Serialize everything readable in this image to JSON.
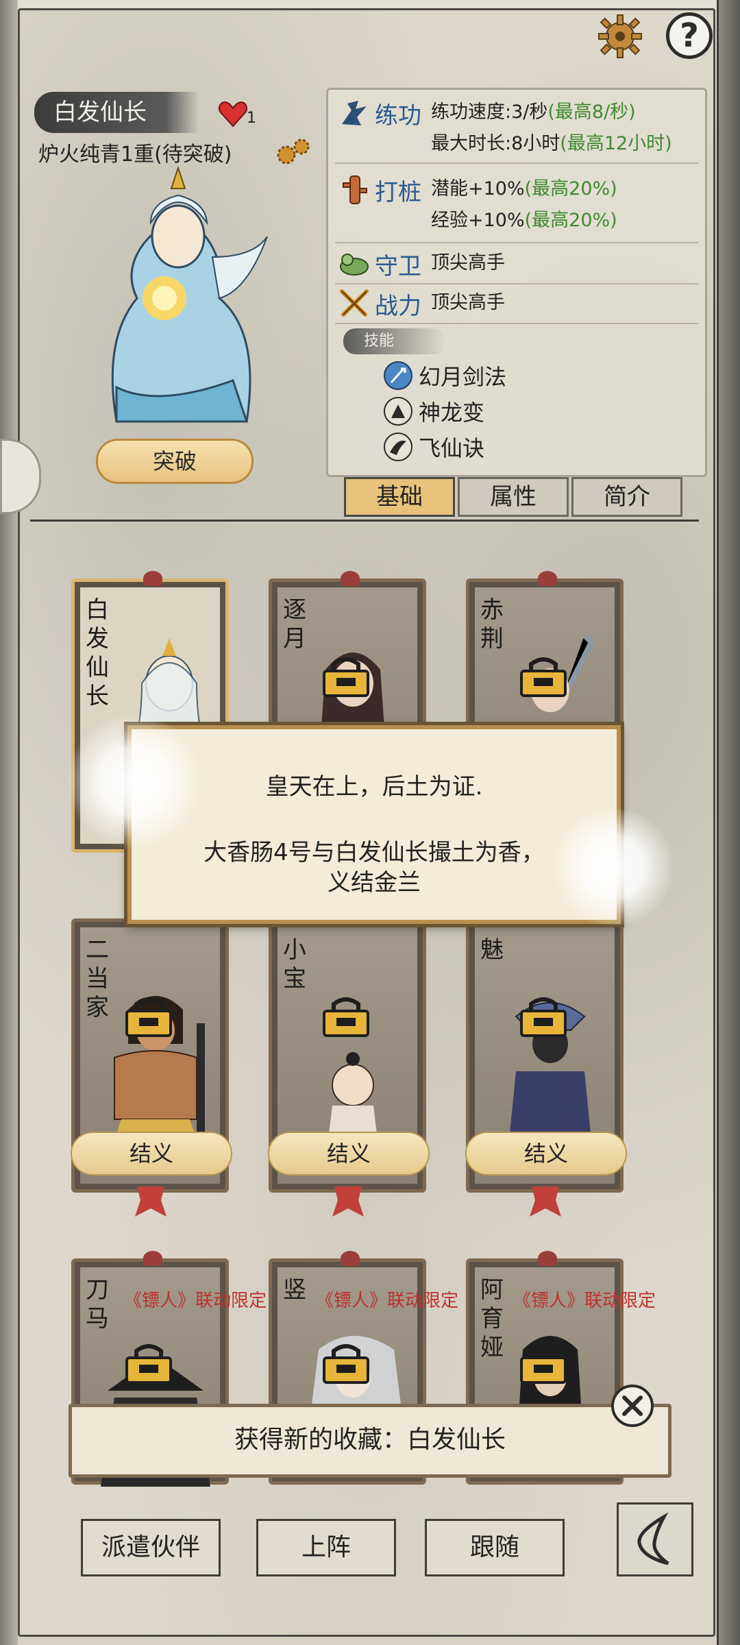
{
  "header": {
    "character_name": "白发仙长",
    "heart_count": "1",
    "realm": "炉火纯青1重(待突破)",
    "breakthrough_label": "突破"
  },
  "stats": {
    "practice": {
      "name": "练功",
      "line1": "练功速度:3/秒",
      "line1_max": "(最高8/秒)",
      "line2": "最大时长:8小时",
      "line2_max": "(最高12小时)"
    },
    "stake": {
      "name": "打桩",
      "line1": "潜能+10%",
      "line1_max": "(最高20%)",
      "line2": "经验+10%",
      "line2_max": "(最高20%)"
    },
    "guard": {
      "name": "守卫",
      "value": "顶尖高手"
    },
    "power": {
      "name": "战力",
      "value": "顶尖高手"
    },
    "skills_header": "技能",
    "skills": [
      "幻月剑法",
      "神龙变",
      "飞仙诀"
    ]
  },
  "tabs": [
    {
      "label": "基础",
      "active": true
    },
    {
      "label": "属性",
      "active": false
    },
    {
      "label": "简介",
      "active": false
    }
  ],
  "cards_row1": [
    {
      "name": "白发仙长",
      "selected": true
    },
    {
      "name": "逐月",
      "selected": false
    },
    {
      "name": "赤荆",
      "selected": false
    }
  ],
  "cards_row2": [
    {
      "name": "二当家",
      "button": "结义"
    },
    {
      "name": "小宝",
      "button": "结义"
    },
    {
      "name": "魅",
      "button": "结义"
    }
  ],
  "cards_row3": [
    {
      "name": "刀马",
      "promo": "《镖人》联动限定"
    },
    {
      "name": "竖",
      "promo": "《镖人》联动限定"
    },
    {
      "name": "阿育娅",
      "promo": "《镖人》联动限定"
    }
  ],
  "dialog": {
    "line1": "皇天在上，后土为证.",
    "line2": "大香肠4号与白发仙长撮土为香，",
    "line3": "义结金兰"
  },
  "toast": {
    "text": "获得新的收藏：白发仙长"
  },
  "bottom_buttons": [
    "派遣伙伴",
    "上阵",
    "跟随"
  ],
  "colors": {
    "stat_name": "#2a5a8e",
    "max_highlight": "#3f8a2e",
    "promo": "#c0312b",
    "active_tab": "#e7c27a"
  }
}
